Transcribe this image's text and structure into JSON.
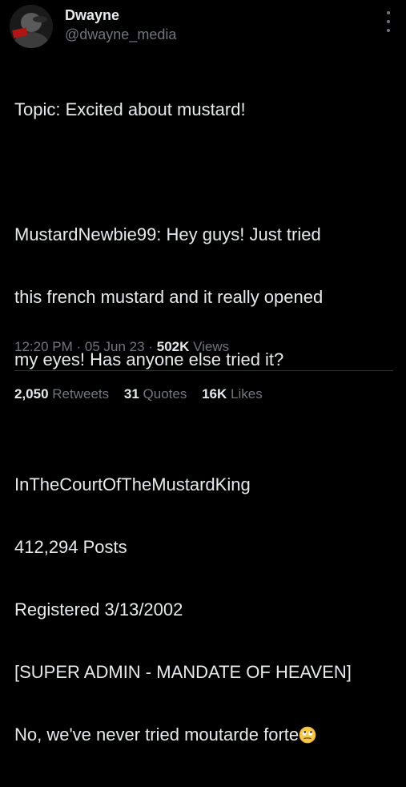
{
  "author": {
    "display_name": "Dwayne",
    "handle": "@dwayne_media"
  },
  "tweet": {
    "lines": [
      "Topic: Excited about mustard!",
      "",
      "MustardNewbie99: Hey guys! Just tried",
      "this french mustard and it really opened",
      "my eyes! Has anyone else tried it?",
      "",
      "InTheCourtOfTheMustardKing",
      "412,294 Posts",
      "Registered 3/13/2002",
      "[SUPER ADMIN - MANDATE OF HEAVEN]",
      "No, we've never tried moutarde forte"
    ],
    "emoji_icon": "rolling-eyes-emoji-icon"
  },
  "meta": {
    "time": "12:20 PM",
    "sep1": "·",
    "date": "05 Jun 23",
    "sep2": "·",
    "views_count": "502K",
    "views_label": "Views"
  },
  "stats": {
    "retweets_count": "2,050",
    "retweets_label": "Retweets",
    "quotes_count": "31",
    "quotes_label": "Quotes",
    "likes_count": "16K",
    "likes_label": "Likes"
  },
  "colors": {
    "background": "#000000",
    "text": "#e7e9ea",
    "muted": "#71767b",
    "divider": "#2f3336"
  }
}
